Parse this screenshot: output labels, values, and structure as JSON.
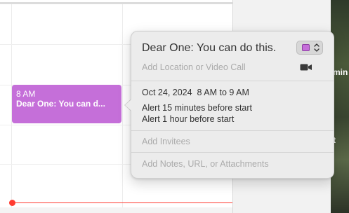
{
  "event": {
    "time": "8 AM",
    "title": "Dear One: You can d..."
  },
  "popover": {
    "title": "Dear One: You can do this.",
    "calendar_color": "#c56fd9",
    "location_placeholder": "Add Location or Video Call",
    "date": "Oct 24, 2024",
    "time_range": "8 AM to 9 AM",
    "alerts": [
      "Alert 15 minutes before start",
      "Alert 1 hour before start"
    ],
    "invitees_placeholder": "Add Invitees",
    "notes_placeholder": "Add Notes, URL, or Attachments"
  },
  "desktop": {
    "fragment_1": "min",
    "fragment_2": "t"
  },
  "colors": {
    "event": "#c56fd9",
    "now_indicator": "#ff3b30",
    "popover_bg": "#ececec"
  },
  "icons": {
    "color_picker": "chevron-up-down-icon",
    "video": "video-camera-icon"
  }
}
